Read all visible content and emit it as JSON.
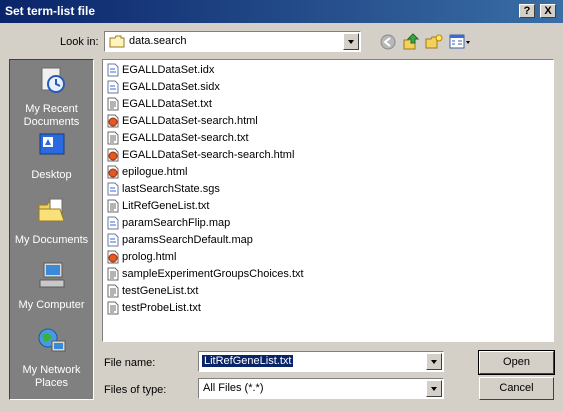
{
  "window": {
    "title": "Set term-list file",
    "help_button": "?",
    "close_button": "X"
  },
  "toolbar": {
    "look_in_label": "Look in:",
    "look_in_value": "data.search"
  },
  "places": [
    {
      "label": "My Recent Documents"
    },
    {
      "label": "Desktop"
    },
    {
      "label": "My Documents"
    },
    {
      "label": "My Computer"
    },
    {
      "label": "My Network Places"
    }
  ],
  "files": [
    {
      "name": "EGALLDataSet.idx",
      "type": "doc"
    },
    {
      "name": "EGALLDataSet.sidx",
      "type": "doc"
    },
    {
      "name": "EGALLDataSet.txt",
      "type": "txt"
    },
    {
      "name": "EGALLDataSet-search.html",
      "type": "html"
    },
    {
      "name": "EGALLDataSet-search.txt",
      "type": "txt"
    },
    {
      "name": "EGALLDataSet-search-search.html",
      "type": "html"
    },
    {
      "name": "epilogue.html",
      "type": "html"
    },
    {
      "name": "lastSearchState.sgs",
      "type": "doc"
    },
    {
      "name": "LitRefGeneList.txt",
      "type": "txt"
    },
    {
      "name": "paramSearchFlip.map",
      "type": "doc"
    },
    {
      "name": "paramsSearchDefault.map",
      "type": "doc"
    },
    {
      "name": "prolog.html",
      "type": "html"
    },
    {
      "name": "sampleExperimentGroupsChoices.txt",
      "type": "txt"
    },
    {
      "name": "testGeneList.txt",
      "type": "txt"
    },
    {
      "name": "testProbeList.txt",
      "type": "txt"
    }
  ],
  "footer": {
    "file_name_label": "File name:",
    "file_name_value": "LitRefGeneList.txt",
    "files_of_type_label": "Files of type:",
    "files_of_type_value": "All Files (*.*)",
    "open_button": "Open",
    "cancel_button": "Cancel"
  },
  "colors": {
    "titlebar": "#0a246a",
    "selection": "#0a246a",
    "places_bg": "#808080"
  }
}
